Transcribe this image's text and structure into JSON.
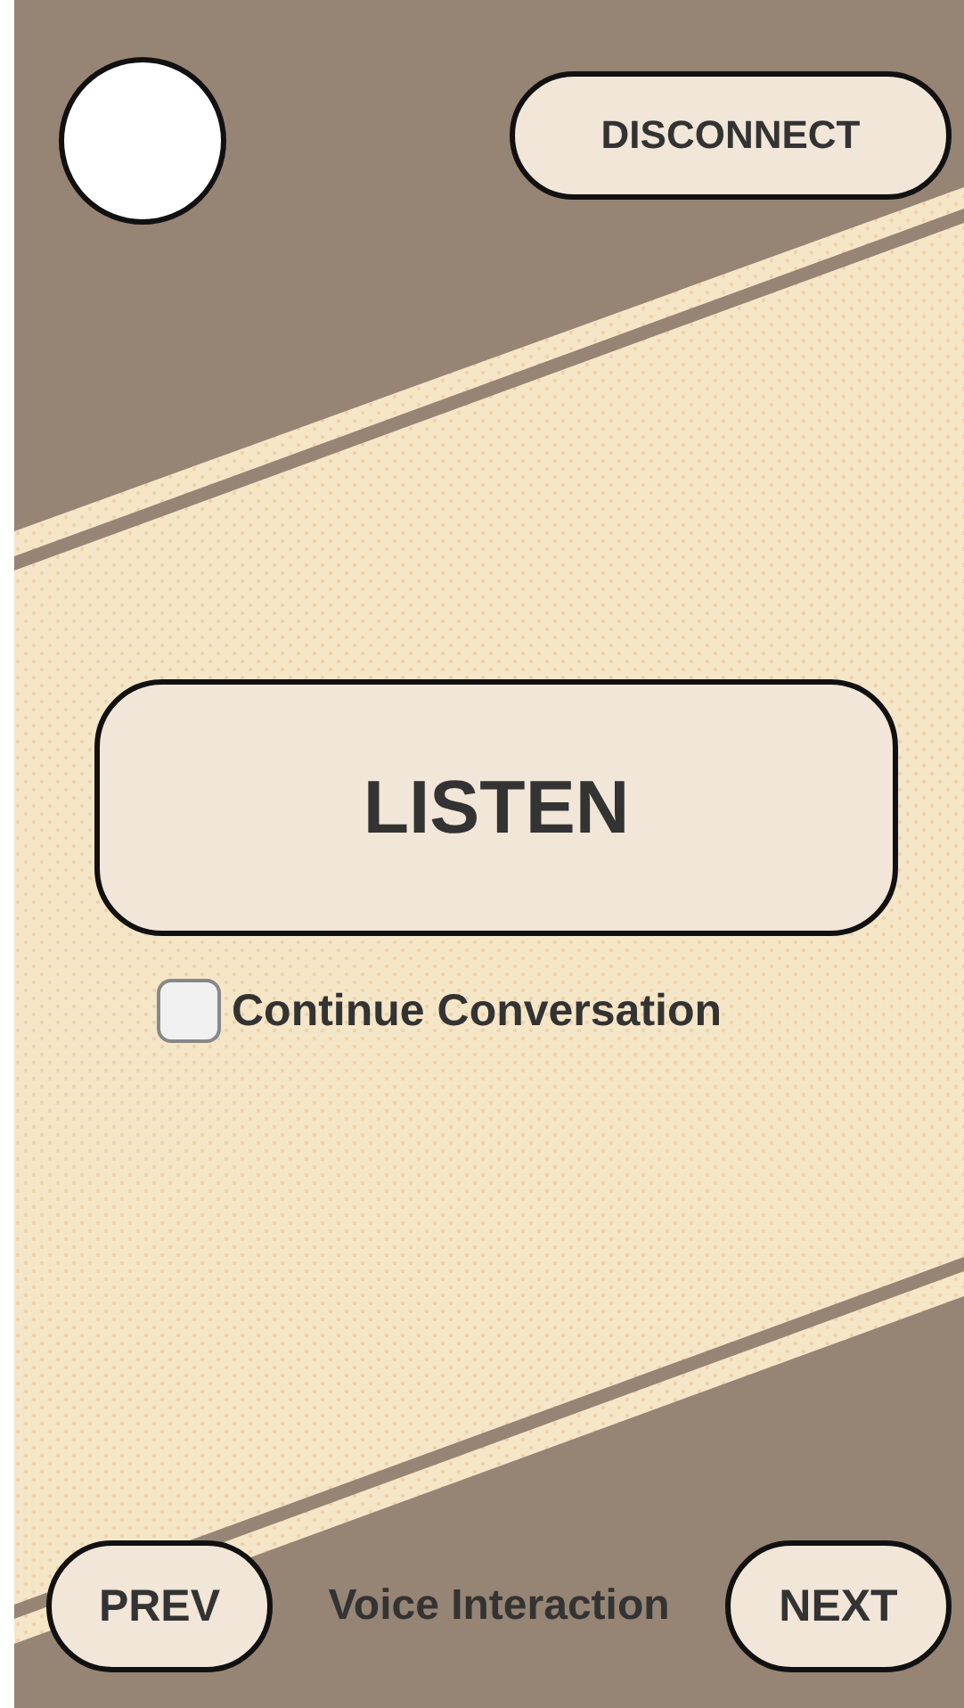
{
  "header": {
    "disconnect_button": "DISCONNECT"
  },
  "listen_button": "LISTEN",
  "continue_conversation": {
    "label": "Continue Conversation",
    "checked": false
  },
  "footer": {
    "prev_button": "PREV",
    "title": "Voice Interaction",
    "next_button": "NEXT"
  }
}
